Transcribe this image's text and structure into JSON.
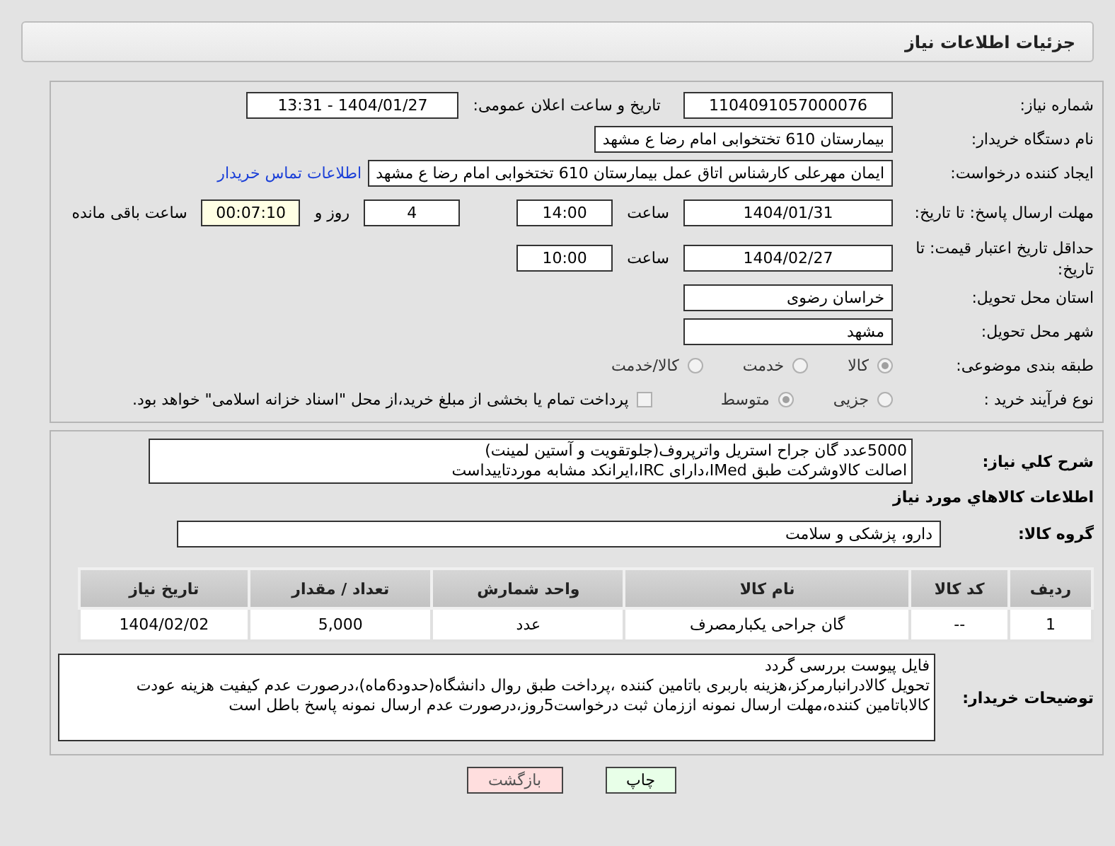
{
  "header": {
    "title": "جزئیات اطلاعات نیاز"
  },
  "need_info": {
    "need_number": {
      "label": "شماره نیاز:",
      "value": "1104091057000076"
    },
    "announce_datetime": {
      "label": "تاریخ و ساعت اعلان عمومی:",
      "value": "1404/01/27 - 13:31"
    },
    "buyer_org": {
      "label": "نام دستگاه خریدار:",
      "value": "بیمارستان 610 تختخوابی امام رضا ع  مشهد"
    },
    "requester": {
      "label": "ایجاد کننده درخواست:",
      "value": "ایمان مهرعلی کارشناس اتاق عمل بیمارستان 610 تختخوابی امام رضا ع  مشهد",
      "link": "اطلاعات تماس خریدار"
    },
    "reply_deadline": {
      "label": "مهلت ارسال پاسخ: تا تاریخ:",
      "date": "1404/01/31",
      "time_label": "ساعت",
      "time": "14:00",
      "days": "4",
      "days_label": "روز و",
      "remaining": "00:07:10",
      "remaining_label": "ساعت باقی مانده"
    },
    "price_validity": {
      "label": "حداقل تاریخ اعتبار قیمت: تا تاریخ:",
      "date": "1404/02/27",
      "time_label": "ساعت",
      "time": "10:00"
    },
    "province": {
      "label": "استان محل تحویل:",
      "value": "خراسان رضوی"
    },
    "city": {
      "label": "شهر محل تحویل:",
      "value": "مشهد"
    },
    "category": {
      "label": "طبقه بندی موضوعی:",
      "options": [
        {
          "label": "کالا",
          "selected": true
        },
        {
          "label": "خدمت",
          "selected": false
        },
        {
          "label": "کالا/خدمت",
          "selected": false
        }
      ]
    },
    "purchase_type": {
      "label": "نوع فرآیند خرید :",
      "options": [
        {
          "label": "جزیی",
          "selected": false
        },
        {
          "label": "متوسط",
          "selected": true
        }
      ],
      "treasury": {
        "label": "پرداخت تمام یا بخشی از مبلغ خرید،از محل \"اسناد خزانه اسلامی\" خواهد بود.",
        "checked": false
      }
    }
  },
  "description": {
    "label": "شرح کلي نياز:",
    "lines": [
      "5000عدد گان جراح استریل واترپروف(جلوتقویت و آستین لمینت)",
      "اصالت کالاوشرکت طبق IMed،دارای IRC،ایرانکد مشابه موردتاییداست"
    ]
  },
  "goods": {
    "title": "اطلاعات کالاهاي مورد نياز",
    "group": {
      "label": "گروه کالا:",
      "value": "دارو، پزشکی و سلامت"
    },
    "table": {
      "columns": [
        "ردیف",
        "کد کالا",
        "نام کالا",
        "واحد شمارش",
        "تعداد / مقدار",
        "تاریخ نیاز"
      ],
      "rows": [
        [
          "1",
          "--",
          "گان جراحی یکبارمصرف",
          "عدد",
          "5,000",
          "1404/02/02"
        ]
      ]
    }
  },
  "buyer_notes": {
    "label": "توضیحات خریدار:",
    "lines": [
      "فایل پیوست بررسی گردد",
      "تحویل کالادرانبارمرکز،هزینه باربری باتامین کننده ،پرداخت طبق روال دانشگاه(حدود6ماه)،درصورت عدم کیفیت هزینه عودت",
      "کالاباتامین کننده،مهلت ارسال نمونه اززمان ثبت درخواست5روز،درصورت عدم ارسال نمونه پاسخ باطل است"
    ]
  },
  "buttons": [
    {
      "label": "چاپ",
      "kind": "print"
    },
    {
      "label": "بازگشت",
      "kind": "back"
    }
  ]
}
